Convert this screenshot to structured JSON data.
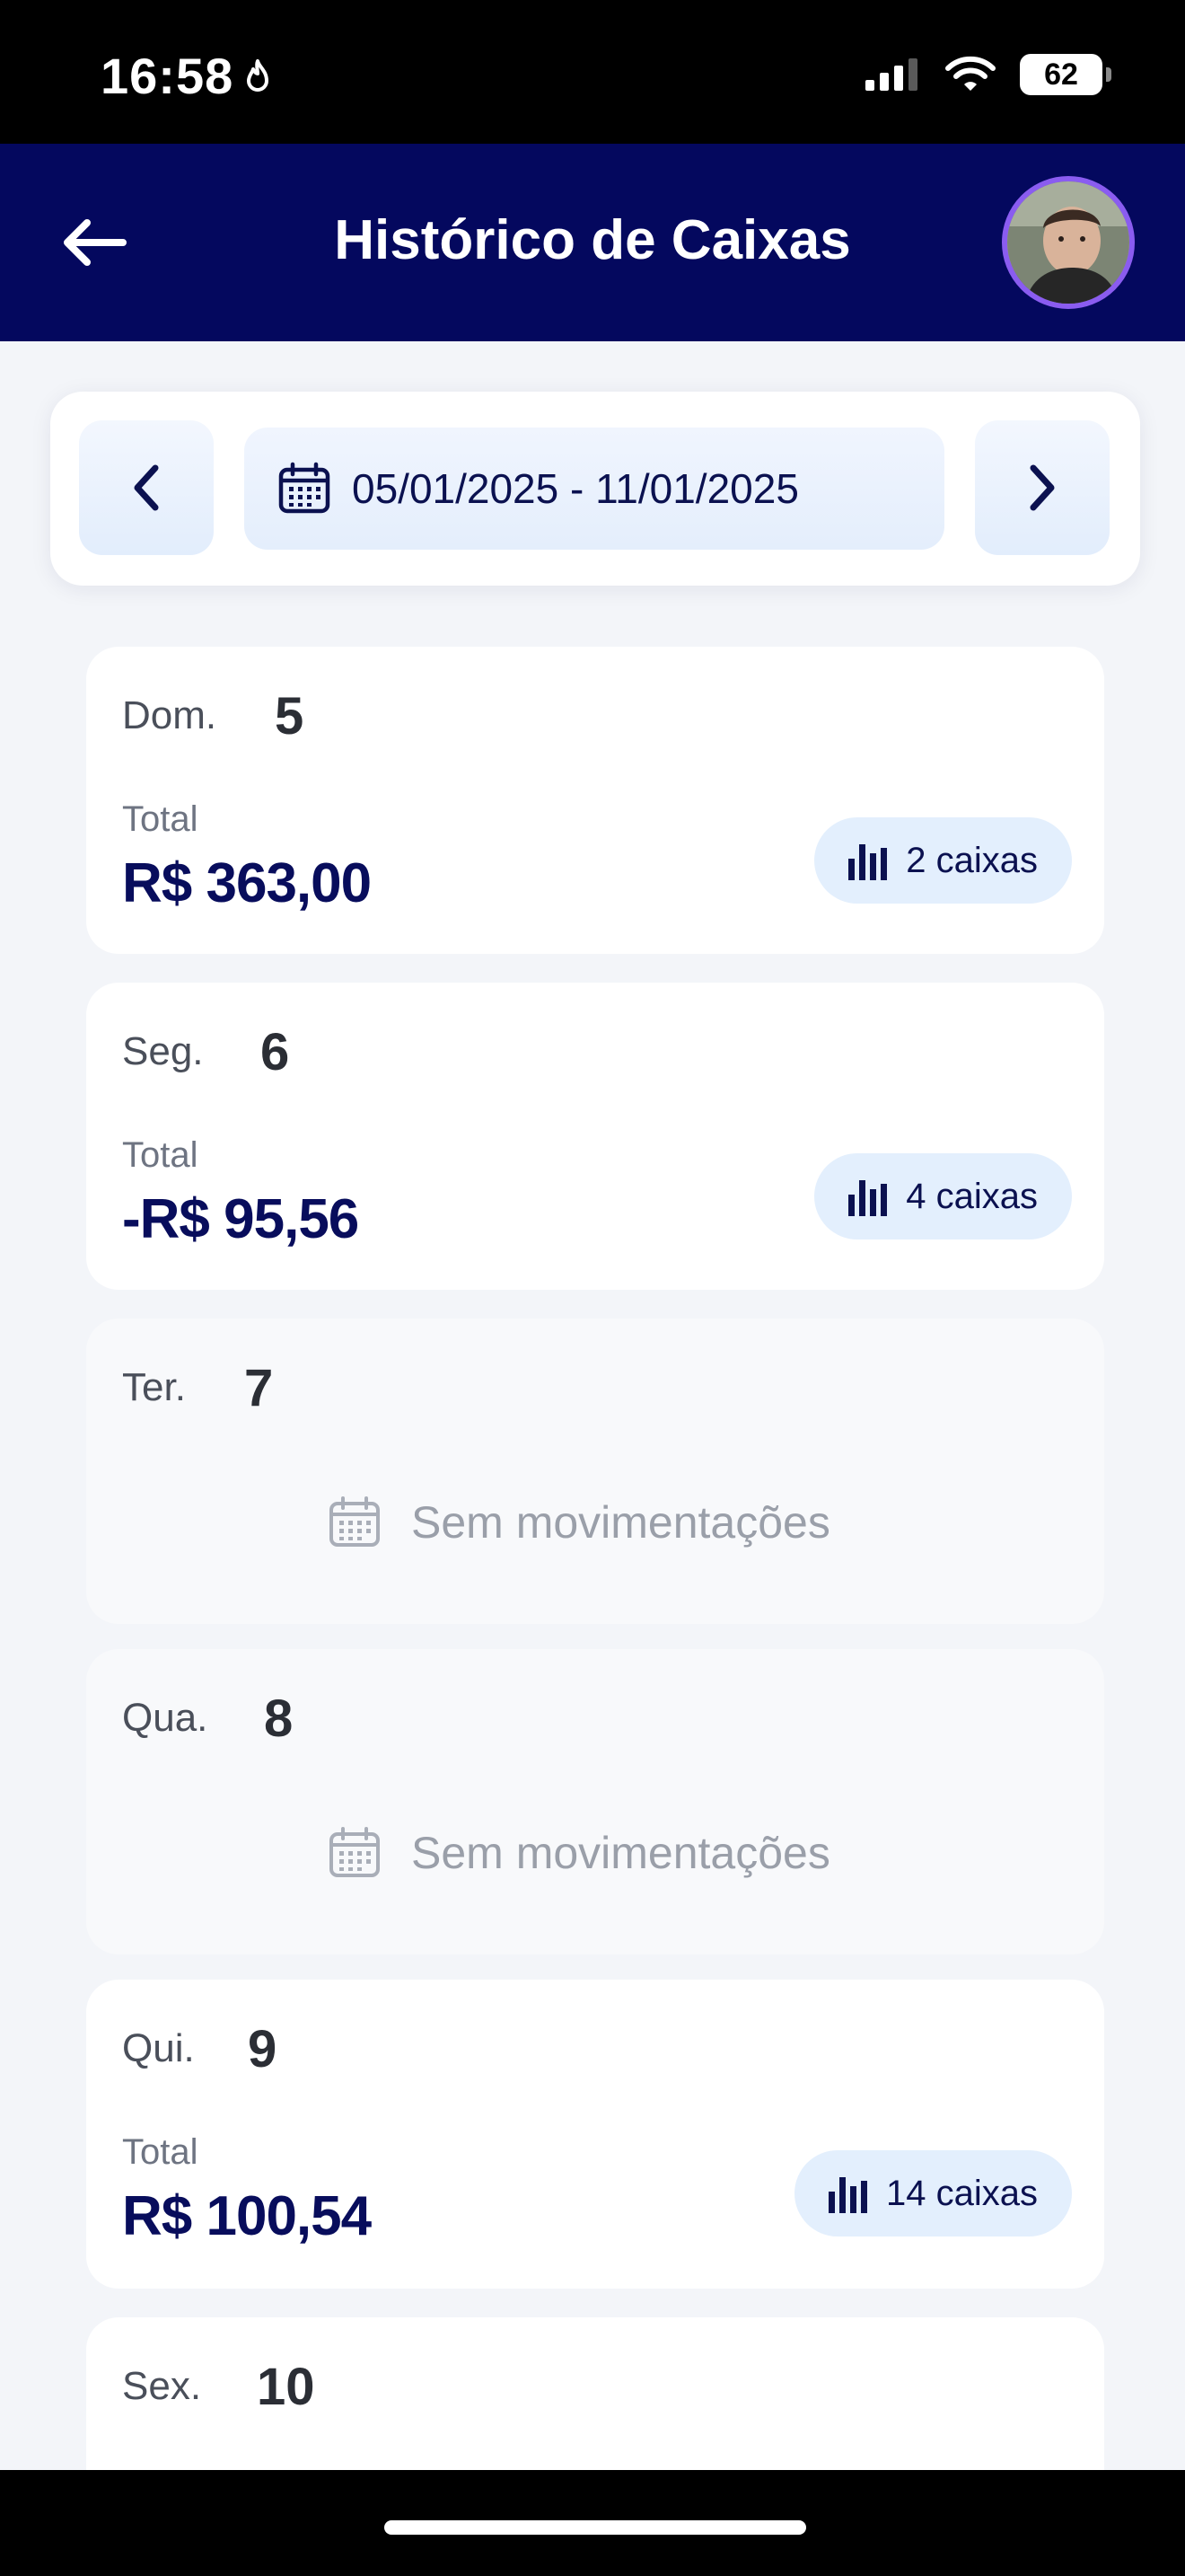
{
  "status_bar": {
    "time": "16:58",
    "battery": "62"
  },
  "header": {
    "title": "Histórico de Caixas"
  },
  "date_filter": {
    "range": "05/01/2025 - 11/01/2025"
  },
  "days": [
    {
      "day_name": "Dom.",
      "day_number": "5",
      "total_label": "Total",
      "total_value": "R$ 363,00",
      "caixas": "2 caixas"
    },
    {
      "day_name": "Seg.",
      "day_number": "6",
      "total_label": "Total",
      "total_value": "-R$ 95,56",
      "caixas": "4 caixas"
    },
    {
      "day_name": "Ter.",
      "day_number": "7",
      "empty_text": "Sem movimentações"
    },
    {
      "day_name": "Qua.",
      "day_number": "8",
      "empty_text": "Sem movimentações"
    },
    {
      "day_name": "Qui.",
      "day_number": "9",
      "total_label": "Total",
      "total_value": "R$ 100,54",
      "caixas": "14 caixas"
    },
    {
      "day_name": "Sex.",
      "day_number": "10"
    }
  ],
  "colors": {
    "header_bg": "#04085e",
    "accent": "#080d5c",
    "badge_bg": "#e3effd",
    "page_bg": "#f3f5f9"
  }
}
